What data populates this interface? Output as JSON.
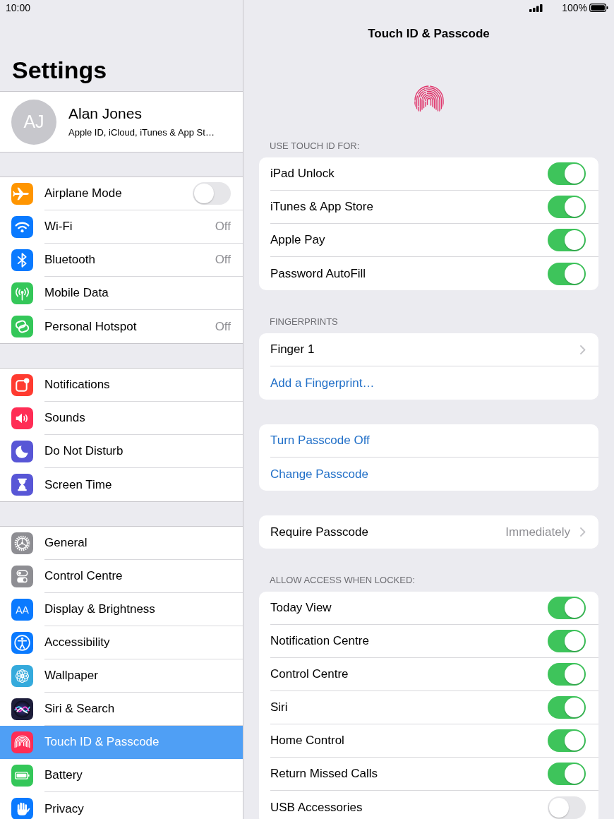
{
  "status_bar": {
    "time": "10:00",
    "battery": "100%"
  },
  "sidebar": {
    "title": "Settings",
    "profile": {
      "initials": "AJ",
      "name": "Alan Jones",
      "subtitle": "Apple ID, iCloud, iTunes & App St…"
    },
    "groups": [
      {
        "items": [
          {
            "label": "Airplane Mode",
            "kind": "toggle",
            "on": false,
            "selected": false
          },
          {
            "label": "Wi-Fi",
            "kind": "value",
            "value": "Off",
            "selected": false
          },
          {
            "label": "Bluetooth",
            "kind": "value",
            "value": "Off",
            "selected": false
          },
          {
            "label": "Mobile Data",
            "kind": "plain",
            "selected": false
          },
          {
            "label": "Personal Hotspot",
            "kind": "value",
            "value": "Off",
            "selected": false
          }
        ]
      },
      {
        "items": [
          {
            "label": "Notifications",
            "kind": "plain",
            "selected": false
          },
          {
            "label": "Sounds",
            "kind": "plain",
            "selected": false
          },
          {
            "label": "Do Not Disturb",
            "kind": "plain",
            "selected": false
          },
          {
            "label": "Screen Time",
            "kind": "plain",
            "selected": false
          }
        ]
      },
      {
        "items": [
          {
            "label": "General",
            "kind": "plain",
            "selected": false
          },
          {
            "label": "Control Centre",
            "kind": "plain",
            "selected": false
          },
          {
            "label": "Display & Brightness",
            "kind": "plain",
            "icon_text": "AA",
            "selected": false
          },
          {
            "label": "Accessibility",
            "kind": "plain",
            "selected": false
          },
          {
            "label": "Wallpaper",
            "kind": "plain",
            "selected": false
          },
          {
            "label": "Siri & Search",
            "kind": "plain",
            "selected": false
          },
          {
            "label": "Touch ID & Passcode",
            "kind": "plain",
            "selected": true
          },
          {
            "label": "Battery",
            "kind": "plain",
            "selected": false
          },
          {
            "label": "Privacy",
            "kind": "plain",
            "selected": false
          }
        ]
      }
    ]
  },
  "detail": {
    "title": "Touch ID & Passcode",
    "sections": [
      {
        "header": "USE TOUCH ID FOR:",
        "rows": [
          {
            "label": "iPad Unlock",
            "kind": "toggle",
            "on": true
          },
          {
            "label": "iTunes & App Store",
            "kind": "toggle",
            "on": true
          },
          {
            "label": "Apple Pay",
            "kind": "toggle",
            "on": true
          },
          {
            "label": "Password AutoFill",
            "kind": "toggle",
            "on": true
          }
        ]
      },
      {
        "header": "FINGERPRINTS",
        "rows": [
          {
            "label": "Finger 1",
            "kind": "nav"
          },
          {
            "label": "Add a Fingerprint…",
            "kind": "action"
          }
        ]
      },
      {
        "rows": [
          {
            "label": "Turn Passcode Off",
            "kind": "action"
          },
          {
            "label": "Change Passcode",
            "kind": "action"
          }
        ]
      },
      {
        "rows": [
          {
            "label": "Require Passcode",
            "kind": "nav",
            "value": "Immediately"
          }
        ]
      },
      {
        "header": "ALLOW ACCESS WHEN LOCKED:",
        "rows": [
          {
            "label": "Today View",
            "kind": "toggle",
            "on": true
          },
          {
            "label": "Notification Centre",
            "kind": "toggle",
            "on": true
          },
          {
            "label": "Control Centre",
            "kind": "toggle",
            "on": true
          },
          {
            "label": "Siri",
            "kind": "toggle",
            "on": true
          },
          {
            "label": "Home Control",
            "kind": "toggle",
            "on": true
          },
          {
            "label": "Return Missed Calls",
            "kind": "toggle",
            "on": true
          },
          {
            "label": "USB Accessories",
            "kind": "toggle",
            "on": false
          }
        ]
      }
    ]
  }
}
